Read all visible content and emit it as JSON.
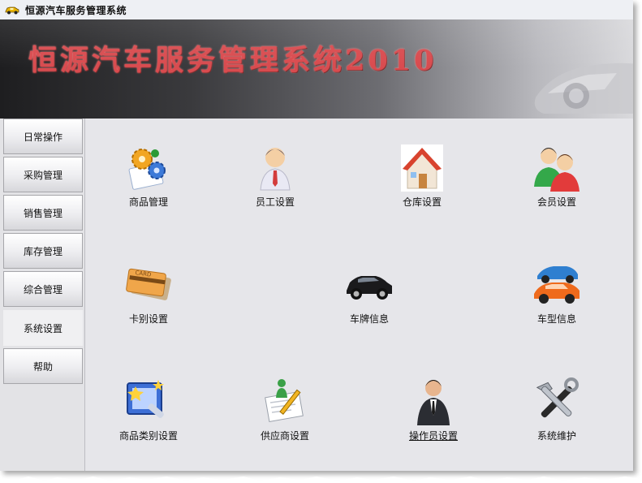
{
  "window": {
    "title": "恒源汽车服务管理系统",
    "app_icon": "car-icon"
  },
  "banner": {
    "title": "恒源汽车服务管理系统2010",
    "title_color": "#d94b4f"
  },
  "sidebar": {
    "items": [
      {
        "label": "日常操作",
        "active": false
      },
      {
        "label": "采购管理",
        "active": false
      },
      {
        "label": "销售管理",
        "active": false
      },
      {
        "label": "库存管理",
        "active": false
      },
      {
        "label": "综合管理",
        "active": false
      },
      {
        "label": "系统设置",
        "active": true
      },
      {
        "label": "帮助",
        "active": false
      }
    ]
  },
  "main": {
    "items": [
      {
        "label": "商品管理",
        "icon": "gears-icon"
      },
      {
        "label": "员工设置",
        "icon": "employee-icon"
      },
      {
        "label": "仓库设置",
        "icon": "house-icon"
      },
      {
        "label": "会员设置",
        "icon": "members-icon"
      },
      {
        "label": "卡别设置",
        "icon": "cards-icon"
      },
      {
        "label": "车牌信息",
        "icon": "black-car-icon"
      },
      {
        "label": "车型信息",
        "icon": "cars-icon"
      },
      {
        "label": "商品类别设置",
        "icon": "category-icon"
      },
      {
        "label": "供应商设置",
        "icon": "supplier-icon"
      },
      {
        "label": "操作员设置",
        "icon": "operator-icon"
      },
      {
        "label": "系统维护",
        "icon": "tools-icon"
      }
    ]
  }
}
